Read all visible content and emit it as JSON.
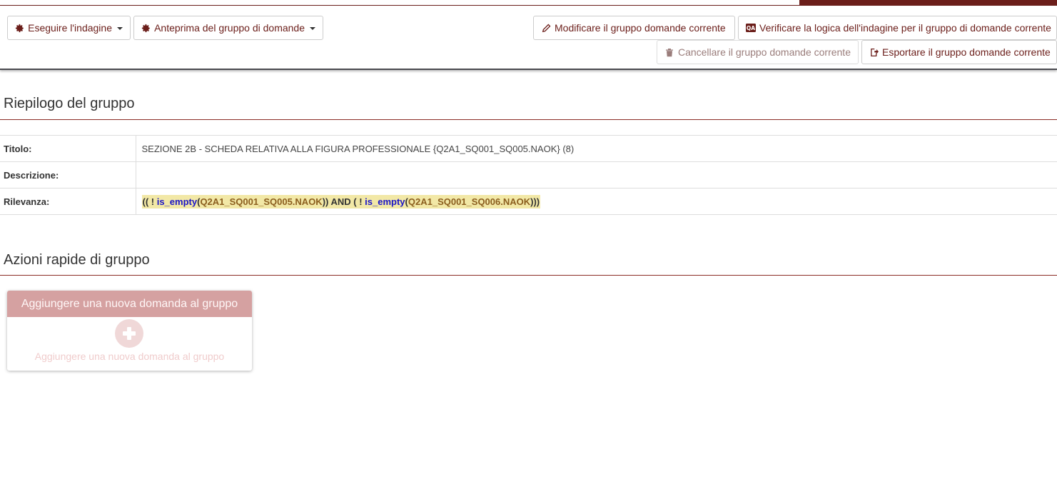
{
  "toolbar": {
    "run_survey": "Eseguire l'indagine",
    "preview_group": "Anteprima del gruppo di domande",
    "edit_group": "Modificare il gruppo domande corrente",
    "check_logic": "Verificare la logica dell'indagine per il gruppo di domande corrente",
    "delete_group": "Cancellare il gruppo domande corrente",
    "export_group": "Esportare il gruppo domande corrente"
  },
  "summary": {
    "heading": "Riepilogo del gruppo",
    "rows": [
      {
        "label": "Titolo:",
        "value": "SEZIONE 2B - SCHEDA RELATIVA ALLA FIGURA PROFESSIONALE {Q2A1_SQ001_SQ005.NAOK} (8)"
      },
      {
        "label": "Descrizione:",
        "value": ""
      },
      {
        "label": "Rilevanza:"
      }
    ],
    "relevance": {
      "open": "(( ! ",
      "fn1": "is_empty",
      "p1": "(",
      "var1": "Q2A1_SQ001_SQ005.NAOK",
      "mid": ")) AND ( ! ",
      "fn2": "is_empty",
      "p2": "(",
      "var2": "Q2A1_SQ001_SQ006.NAOK",
      "close": ")))"
    }
  },
  "quick_actions": {
    "heading": "Azioni rapide di gruppo",
    "card_title": "Aggiungere una nuova domanda al gruppo",
    "card_text": "Aggiungere una nuova domanda al gruppo"
  },
  "colors": {
    "brand": "#6b1e1a",
    "rule": "#8a2c25",
    "card_header": "#d5a1a1",
    "relevance_highlight": "#f2e8a6"
  }
}
